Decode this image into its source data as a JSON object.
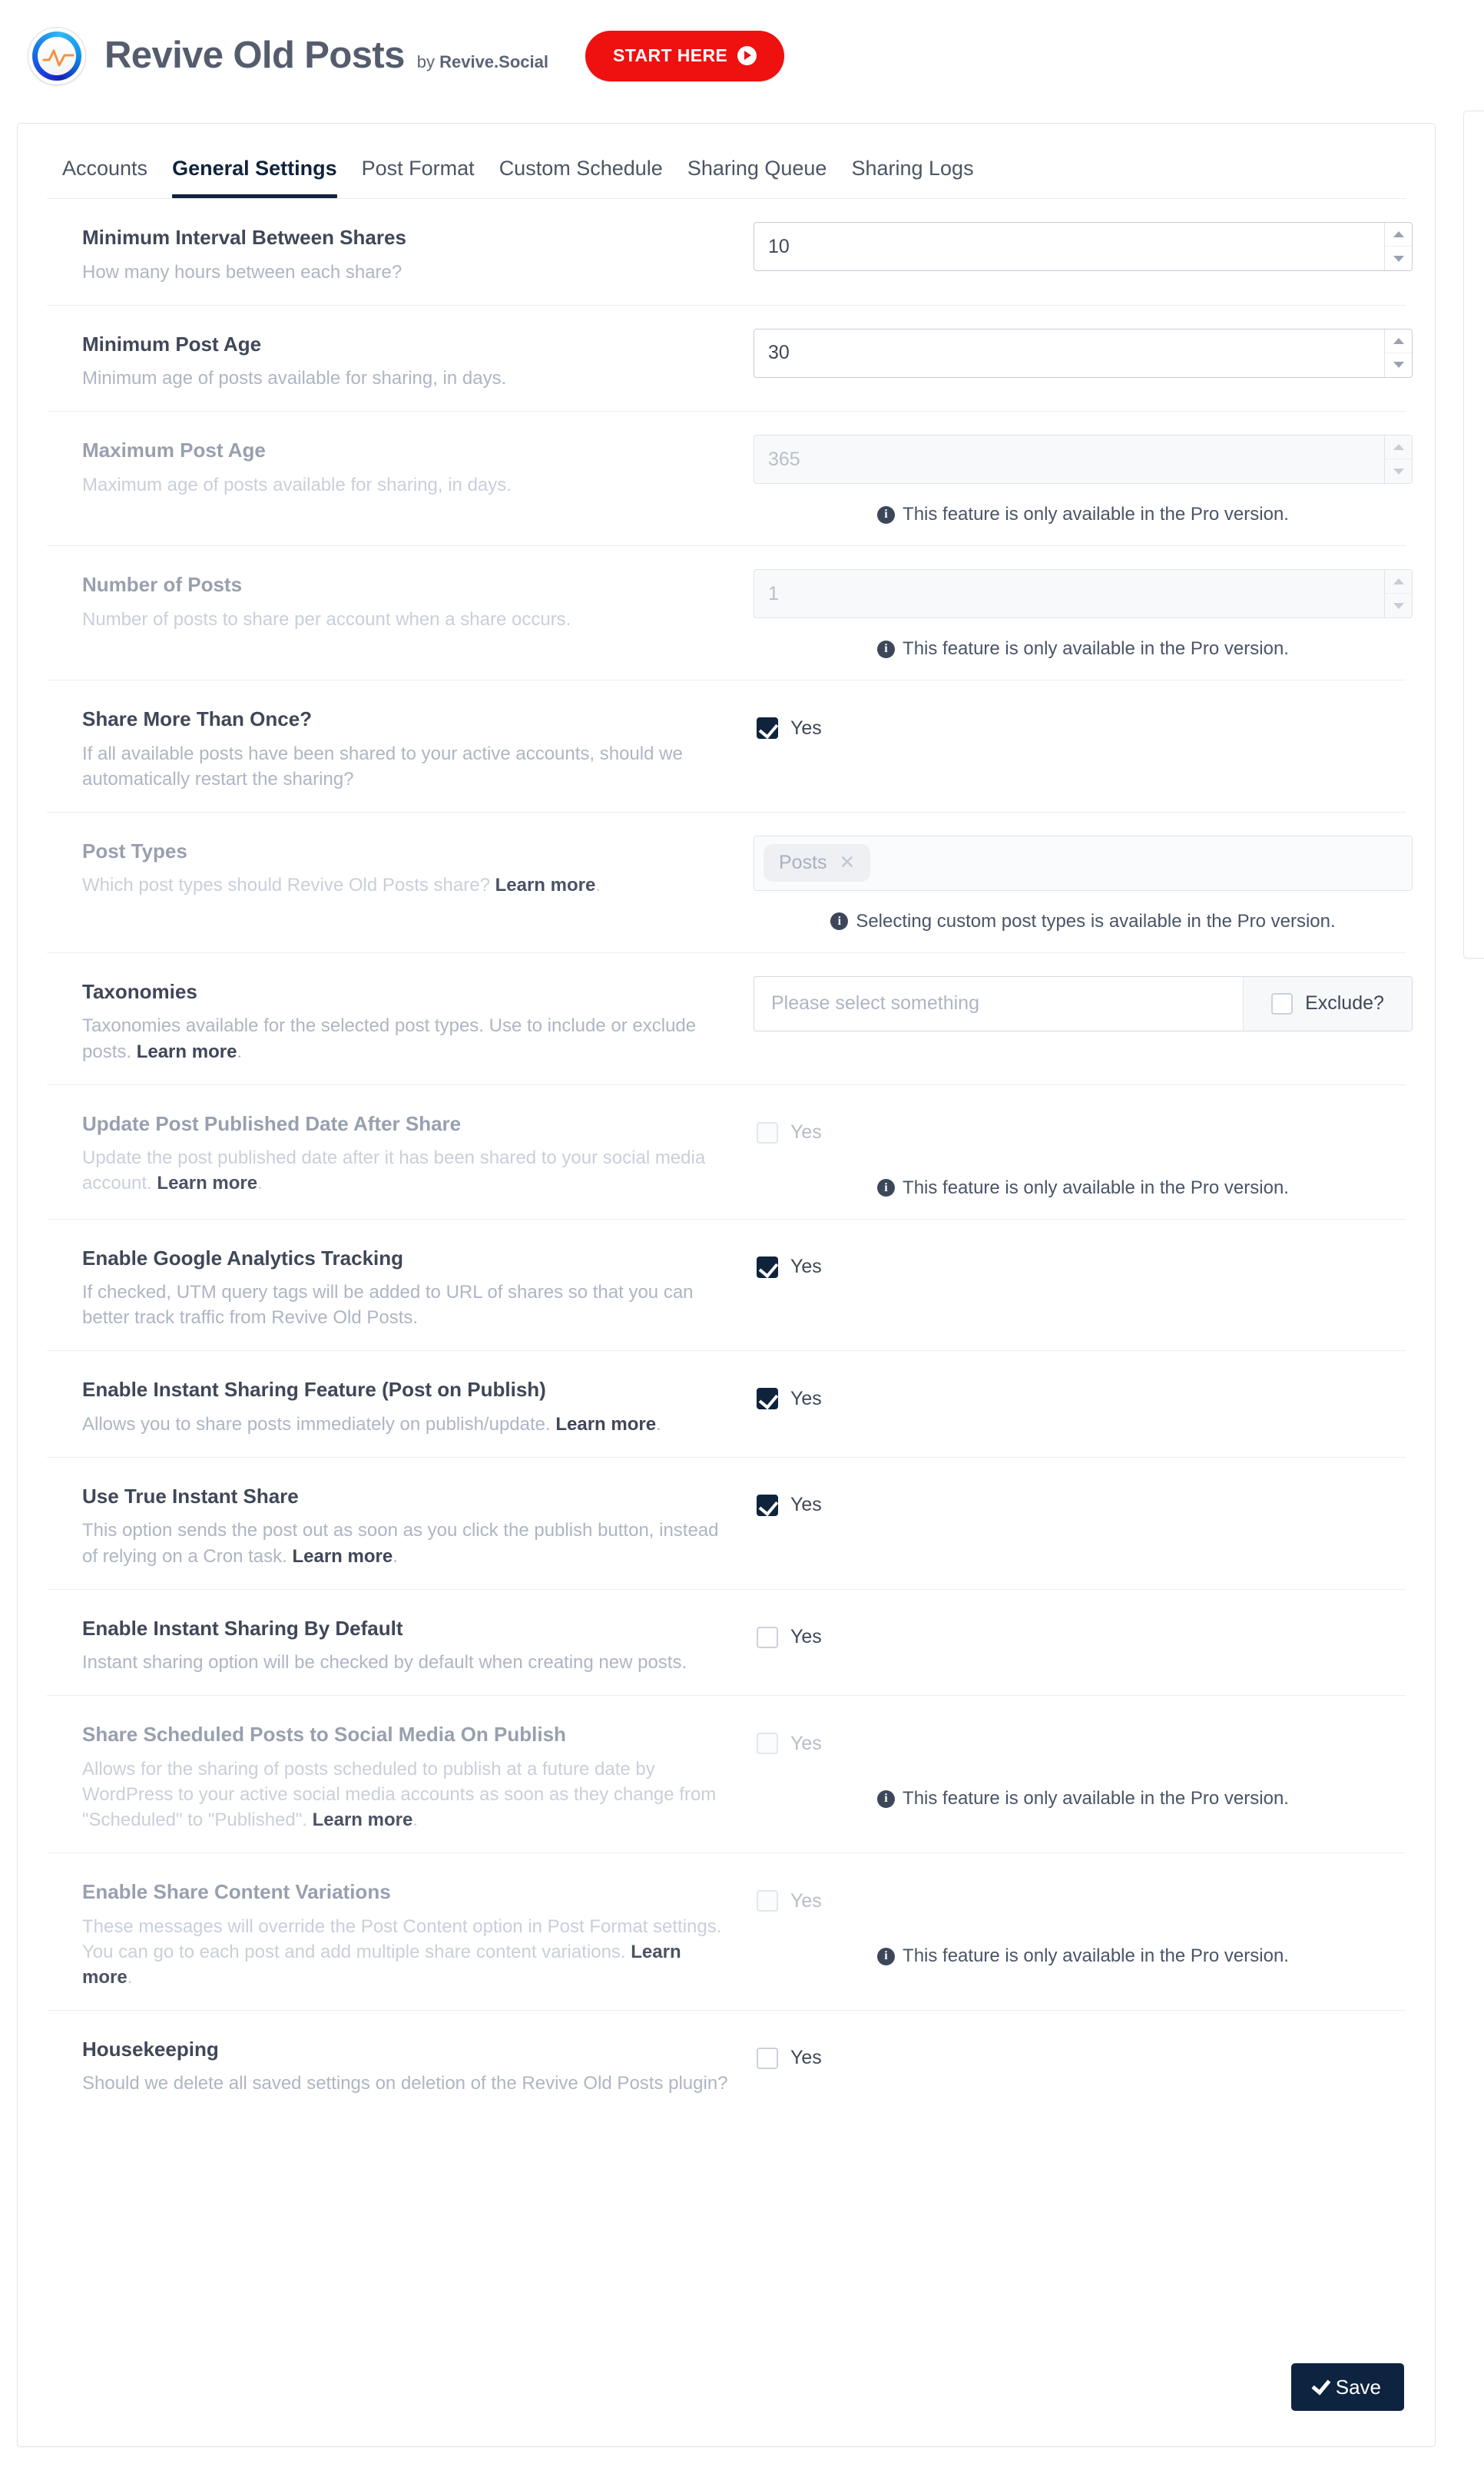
{
  "header": {
    "app_title": "Revive Old Posts",
    "byline_prefix": "by ",
    "byline_brand": "Revive.Social",
    "start_here_label": "START HERE",
    "logo_icon": "revive-circle-logo-icon",
    "play_icon": "play-icon",
    "brand_red": "#ef1010",
    "brand_navy": "#10233d"
  },
  "tabs": [
    {
      "label": "Accounts",
      "active": false
    },
    {
      "label": "General Settings",
      "active": true
    },
    {
      "label": "Post Format",
      "active": false
    },
    {
      "label": "Custom Schedule",
      "active": false
    },
    {
      "label": "Sharing Queue",
      "active": false
    },
    {
      "label": "Sharing Logs",
      "active": false
    }
  ],
  "common": {
    "yes_label": "Yes",
    "pro_note": "This feature is only available in the Pro version.",
    "info_icon": "info-icon",
    "learn_more": "Learn more",
    "exclude_label": "Exclude?"
  },
  "rows": {
    "min_interval": {
      "title": "Minimum Interval Between Shares",
      "desc": "How many hours between each share?",
      "value": "10"
    },
    "min_post_age": {
      "title": "Minimum Post Age",
      "desc": "Minimum age of posts available for sharing, in days.",
      "value": "30"
    },
    "max_post_age": {
      "title": "Maximum Post Age",
      "desc": "Maximum age of posts available for sharing, in days.",
      "value": "365"
    },
    "number_of_posts": {
      "title": "Number of Posts",
      "desc": "Number of posts to share per account when a share occurs.",
      "value": "1"
    },
    "share_more_than_once": {
      "title": "Share More Than Once?",
      "desc": "If all available posts have been shared to your active accounts, should we automatically restart the sharing?",
      "checked": true
    },
    "post_types": {
      "title": "Post Types",
      "desc_before": "Which post types should Revive Old Posts share? ",
      "desc_link": "Learn more",
      "desc_after": ".",
      "tokens": [
        "Posts"
      ],
      "remove_icon": "remove-token-icon",
      "note": "Selecting custom post types is available in the Pro version."
    },
    "taxonomies": {
      "title": "Taxonomies",
      "desc_before": "Taxonomies available for the selected post types. Use to include or exclude posts. ",
      "desc_link": "Learn more",
      "desc_after": ".",
      "placeholder": "Please select something",
      "exclude_checked": false
    },
    "update_published_date": {
      "title": "Update Post Published Date After Share",
      "desc_before": "Update the post published date after it has been shared to your social media account. ",
      "desc_link": "Learn more",
      "desc_after": ".",
      "checked": false
    },
    "google_analytics": {
      "title": "Enable Google Analytics Tracking",
      "desc": "If checked, UTM query tags will be added to URL of shares so that you can better track traffic from Revive Old Posts.",
      "checked": true
    },
    "instant_sharing": {
      "title": "Enable Instant Sharing Feature (Post on Publish)",
      "desc_before": "Allows you to share posts immediately on publish/update. ",
      "desc_link": "Learn more",
      "desc_after": ".",
      "checked": true
    },
    "true_instant_share": {
      "title": "Use True Instant Share",
      "desc_before": "This option sends the post out as soon as you click the publish button, instead of relying on a Cron task. ",
      "desc_link": "Learn more",
      "desc_after": ".",
      "checked": true
    },
    "instant_by_default": {
      "title": "Enable Instant Sharing By Default",
      "desc": "Instant sharing option will be checked by default when creating new posts.",
      "checked": false
    },
    "share_scheduled": {
      "title": "Share Scheduled Posts to Social Media On Publish",
      "desc_before": "Allows for the sharing of posts scheduled to publish at a future date by WordPress to your active social media accounts as soon as they change from \"Scheduled\" to \"Published\". ",
      "desc_link": "Learn more",
      "desc_after": ".",
      "checked": false
    },
    "content_variations": {
      "title": "Enable Share Content Variations",
      "desc_before": "These messages will override the Post Content option in Post Format settings. You can go to each post and add multiple share content variations. ",
      "desc_link": "Learn more",
      "desc_after": ".",
      "checked": false
    },
    "housekeeping": {
      "title": "Housekeeping",
      "desc": "Should we delete all saved settings on deletion of the Revive Old Posts plugin?",
      "checked": false
    }
  },
  "footer": {
    "save_label": "Save",
    "save_icon": "check-icon"
  }
}
